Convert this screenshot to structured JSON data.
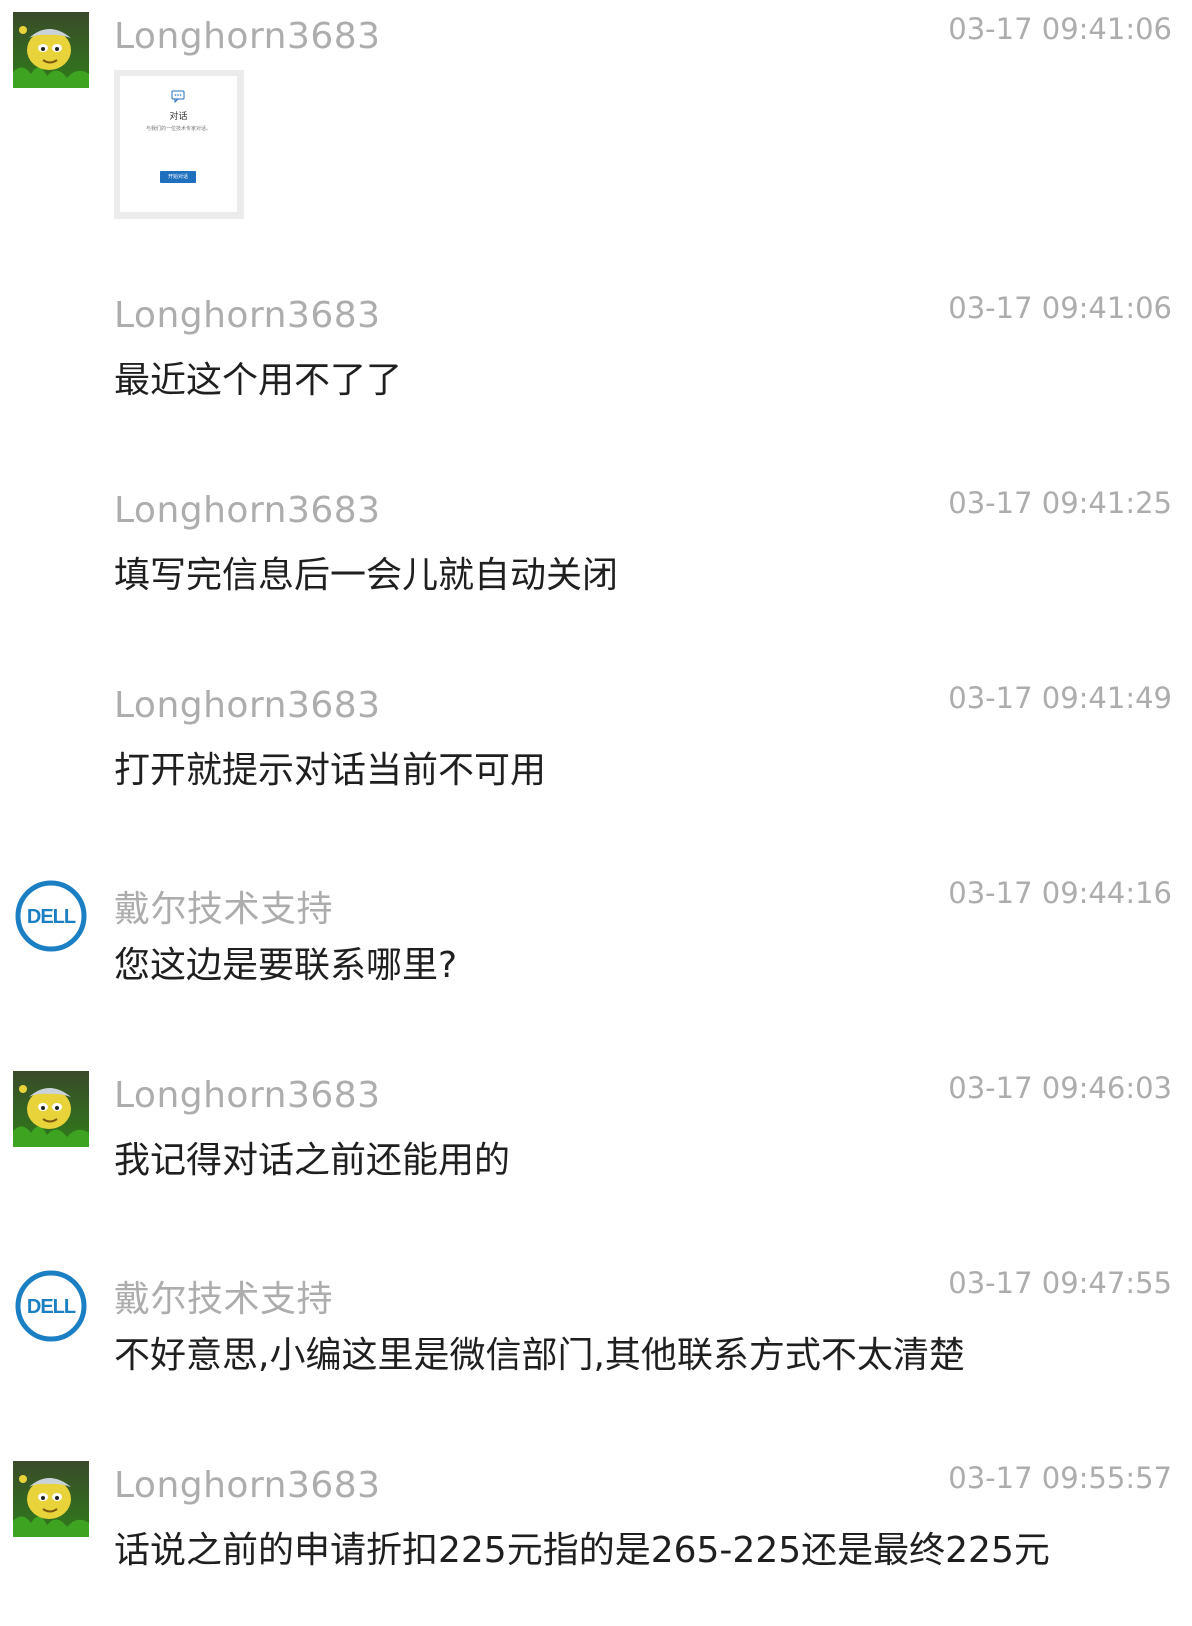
{
  "colors": {
    "meta_gray": "#adadad",
    "text": "#1f1f1f",
    "dell_blue": "#1b7fc3"
  },
  "messages": [
    {
      "sender": "Longhorn3683",
      "time": "03-17 09:41:06",
      "avatar": "user",
      "type": "image",
      "image": {
        "title": "对话",
        "subtitle": "与我们的一位技术专家对话。",
        "button": "开始对话",
        "icon": "chat-bubble-icon"
      }
    },
    {
      "sender": "Longhorn3683",
      "time": "03-17 09:41:06",
      "avatar": "none",
      "text": "最近这个用不了了"
    },
    {
      "sender": "Longhorn3683",
      "time": "03-17 09:41:25",
      "avatar": "none",
      "text": "填写完信息后一会儿就自动关闭"
    },
    {
      "sender": "Longhorn3683",
      "time": "03-17 09:41:49",
      "avatar": "none",
      "text": "打开就提示对话当前不可用"
    },
    {
      "sender": "戴尔技术支持",
      "time": "03-17 09:44:16",
      "avatar": "dell",
      "text": "您这边是要联系哪里?"
    },
    {
      "sender": "Longhorn3683",
      "time": "03-17 09:46:03",
      "avatar": "user",
      "text": "我记得对话之前还能用的"
    },
    {
      "sender": "戴尔技术支持",
      "time": "03-17 09:47:55",
      "avatar": "dell",
      "text": "不好意思,小编这里是微信部门,其他联系方式不太清楚"
    },
    {
      "sender": "Longhorn3683",
      "time": "03-17 09:55:57",
      "avatar": "user",
      "text": "话说之前的申请折扣225元指的是265-225还是最终225元"
    }
  ],
  "dell_logo_text": "DELL"
}
